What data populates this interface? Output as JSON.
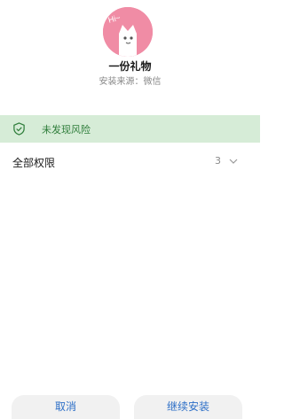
{
  "app": {
    "icon_name": "pink-cat-icon",
    "icon_text": "Hi~",
    "name": "一份礼物",
    "source": "安装来源：微信"
  },
  "risk": {
    "icon_name": "shield-check-icon",
    "text": "未发现风险",
    "color": "#2e7d3a",
    "background": "#d6ecd7"
  },
  "permissions": {
    "label": "全部权限",
    "count": "3",
    "icon_name": "chevron-down-icon"
  },
  "actions": {
    "cancel_label": "取消",
    "continue_label": "继续安装",
    "color": "#2d6fc7"
  }
}
